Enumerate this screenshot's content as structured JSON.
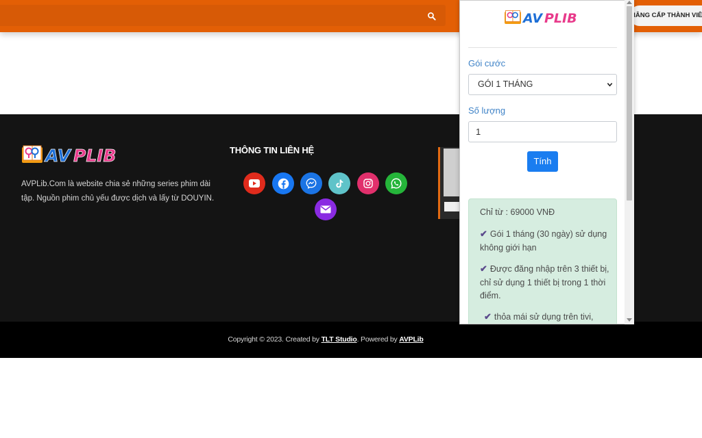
{
  "header": {
    "upgrade_label": "NÂNG CẤP THÀNH VIÊN"
  },
  "brand": {
    "logo_text": "AVPLIB",
    "logo_blue": "#1e6fd6",
    "logo_pink": "#e83a8b"
  },
  "footer": {
    "description": "AVPLib.Com là website chia sẻ những series phim dài tập. Nguồn phim chủ yếu được dịch và lấy từ DOUYIN.",
    "contact_title": "THÔNG TIN LIÊN HỆ",
    "social": [
      {
        "name": "youtube-icon",
        "color": "#e02b1c"
      },
      {
        "name": "facebook-icon",
        "color": "#1877f2"
      },
      {
        "name": "messenger-icon",
        "color": "#1b74e4"
      },
      {
        "name": "tiktok-icon",
        "color": "#5fc3c9"
      },
      {
        "name": "instagram-icon",
        "color": "#e1306c"
      },
      {
        "name": "whatsapp-icon",
        "color": "#25b53a"
      },
      {
        "name": "email-icon",
        "color": "#8a2be2"
      }
    ]
  },
  "copyright": {
    "prefix": "Copyright © 2023. Created by ",
    "studio": "TLT Studio",
    "middle": ". Powered by ",
    "powered": "AVPLib"
  },
  "popup": {
    "plan_label": "Gói cước",
    "plan_value": "GÓI 1 THÁNG",
    "quantity_label": "Số lượng",
    "quantity_value": "1",
    "calc_button": "Tính",
    "price": "Chỉ từ : 69000 VNĐ",
    "features": [
      "Gói 1 tháng (30 ngày) sử dụng không giới hạn",
      "Được đăng nhập trên 3 thiết bị, chỉ sử dụng 1 thiết bị trong 1 thời điểm.",
      "thỏa mái sử dụng trên tivi,"
    ]
  }
}
